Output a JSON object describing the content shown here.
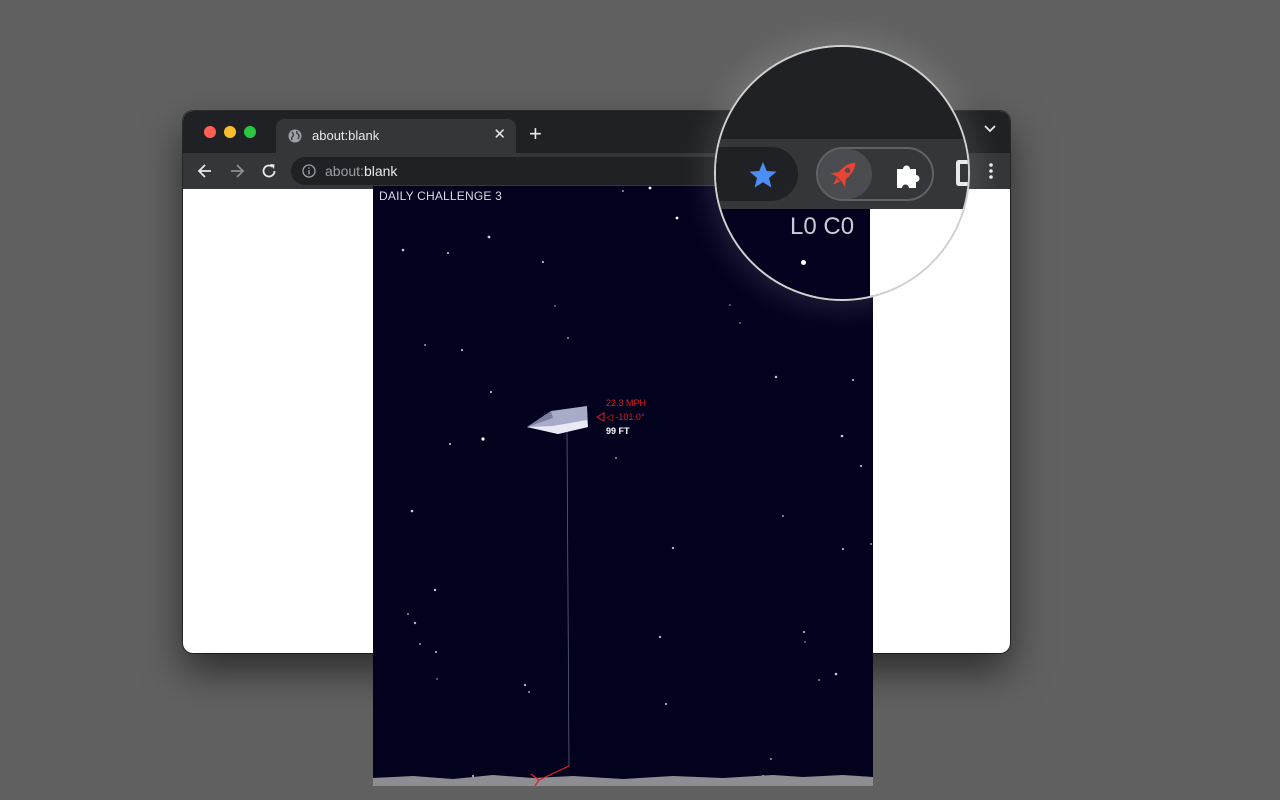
{
  "window": {
    "tab": {
      "title": "about:blank",
      "close": "✕"
    },
    "new_tab": "+",
    "address": {
      "prefix": "about:",
      "host": "blank"
    }
  },
  "game": {
    "challenge_label": "DAILY CHALLENGE 3",
    "hud": {
      "speed": "22.3 MPH",
      "angle": "◁ -101.0°",
      "altitude": "99 FT"
    }
  },
  "magnifier": {
    "score": "L0 C0",
    "icons": [
      "bookmark-star-icon",
      "rocket-extension-icon",
      "extensions-puzzle-icon",
      "side-panel-icon"
    ]
  },
  "colors": {
    "page_bg": "#616161",
    "chrome_dark": "#202124",
    "chrome_toolbar": "#35363a",
    "space": "#02021f",
    "hud_red": "#e02020",
    "star_blue": "#4c8df6",
    "rocket_red": "#ea4335"
  }
}
